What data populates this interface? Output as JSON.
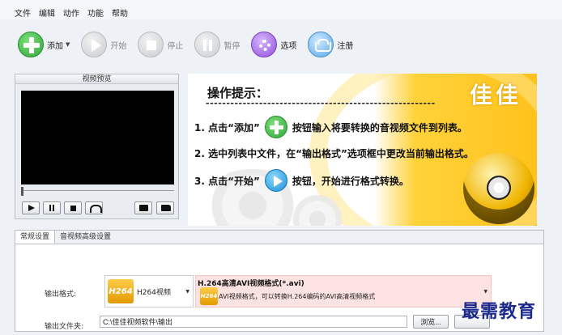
{
  "menu": [
    "文件",
    "编辑",
    "动作",
    "功能",
    "帮助"
  ],
  "toolbar": {
    "add": "添加",
    "start": "开始",
    "stop": "停止",
    "pause": "暂停",
    "options": "选项",
    "register": "注册"
  },
  "preview": {
    "title": "视频预览"
  },
  "hint": {
    "title": "操作提示：",
    "dashes": "--------------------------------------------------------",
    "logo": "佳佳",
    "step1_a": "1. 点击“添加”",
    "step1_b": "按钮输入将要转换的音视频文件到列表。",
    "step2": "2. 选中列表中文件，在“输出格式”选项框中更改当前输出格式。",
    "step3_a": "3. 点击“开始”",
    "step3_b": "按钮，开始进行格式转换。"
  },
  "tabs": [
    "常规设置",
    "音视频高级设置"
  ],
  "settings": {
    "format_label": "输出格式:",
    "format_badge": "H264",
    "format_select_text": "H264视频",
    "format_detail_title": "H.264高清AVI视频格式(*.avi)",
    "format_detail_desc": "AVI视频格式，可以转换H.264编码的AVI高清视频格式",
    "output_label": "输出文件夹:",
    "output_path": "C:\\佳佳视频软件\\输出",
    "browse": "浏览..."
  },
  "watermark": "最需教育",
  "colors": {
    "accent_green": "#2ea63a",
    "hint_yellow": "#ffc21c",
    "format_detail_bg": "#fde2e2",
    "watermark": "#1b2a8c"
  },
  "icons": {
    "add": "plus-circle-icon",
    "start": "play-circle-icon",
    "stop": "stop-circle-icon",
    "pause": "pause-circle-icon",
    "options": "gear-icon",
    "register": "basket-icon"
  }
}
